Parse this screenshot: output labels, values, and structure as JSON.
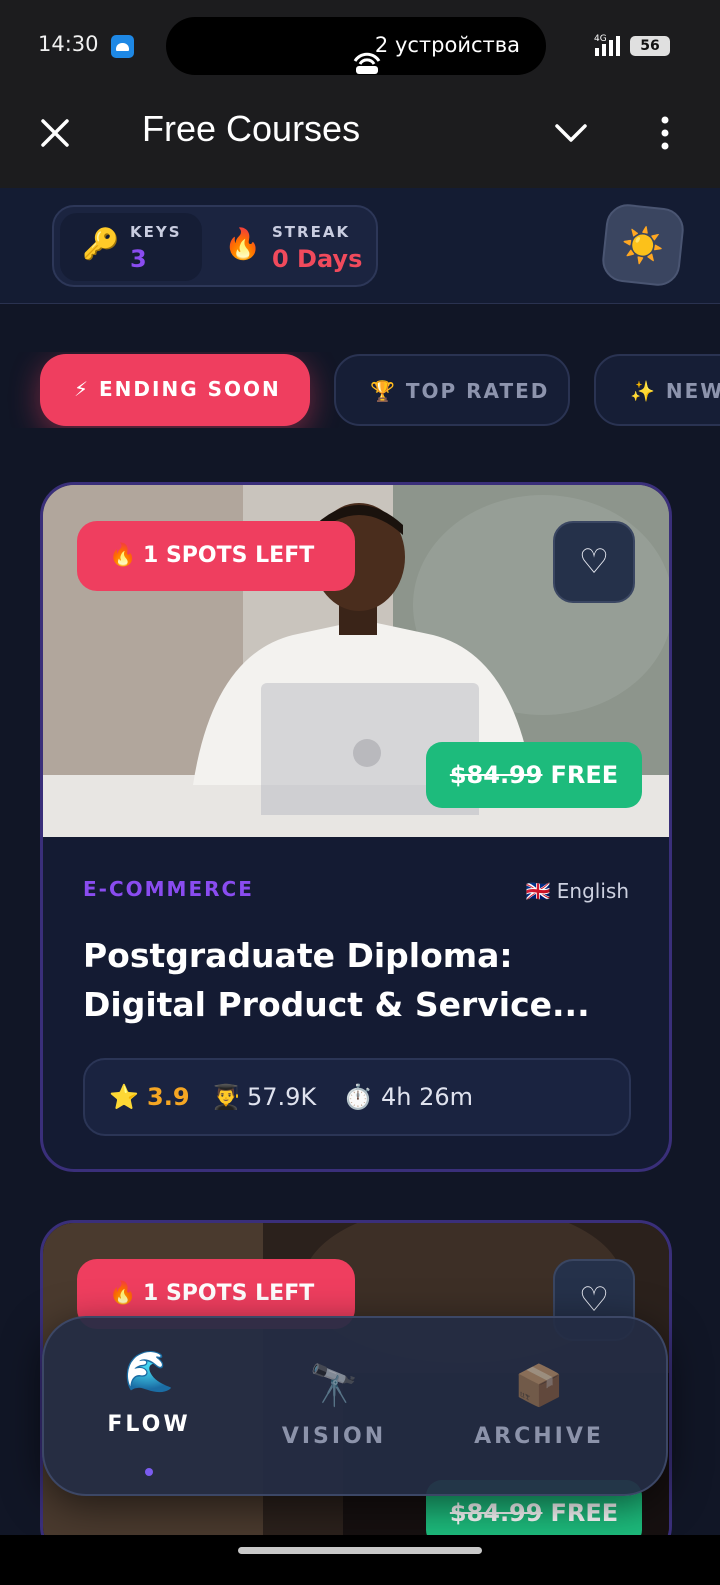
{
  "status_bar": {
    "time": "14:30",
    "devices": "2 устройства",
    "network": "4G",
    "battery": "56"
  },
  "title_bar": {
    "title": "Free Courses"
  },
  "header": {
    "keys_label": "KEYS",
    "keys_value": "3",
    "streak_label": "STREAK",
    "streak_value": "0 Days",
    "key_emoji": "🔑",
    "fire_emoji": "🔥",
    "theme_emoji": "☀️"
  },
  "filters": [
    {
      "emoji": "⚡",
      "label": "ENDING SOON",
      "active": true
    },
    {
      "emoji": "🏆",
      "label": "TOP RATED",
      "active": false
    },
    {
      "emoji": "✨",
      "label": "NEW",
      "active": false
    }
  ],
  "courses": [
    {
      "spots": "1 SPOTS LEFT",
      "spots_emoji": "🔥",
      "heart": "♡",
      "old_price": "$84.99",
      "new_price": "FREE",
      "category": "E-COMMERCE",
      "language": "🇬🇧 English",
      "title": "Postgraduate Diploma: Digital Product & Service...",
      "rating_emoji": "⭐",
      "rating": "3.9",
      "students_emoji": "👨‍🎓",
      "students": "57.9K",
      "duration_emoji": "⏱️",
      "duration": "4h 26m"
    },
    {
      "spots": "1 SPOTS LEFT",
      "spots_emoji": "🔥",
      "heart": "♡",
      "old_price": "$84.99",
      "new_price": "FREE"
    }
  ],
  "nav": [
    {
      "emoji": "🌊",
      "label": "FLOW",
      "active": true
    },
    {
      "emoji": "🔭",
      "label": "VISION",
      "active": false
    },
    {
      "emoji": "📦",
      "label": "ARCHIVE",
      "active": false
    }
  ],
  "colors": {
    "accent_red": "#ef3e5f",
    "accent_green": "#1dbb7c",
    "accent_purple": "#8a4cf0",
    "rating_gold": "#f5a623",
    "streak_red": "#f04a5c",
    "keys_purple": "#8a4cf0"
  }
}
